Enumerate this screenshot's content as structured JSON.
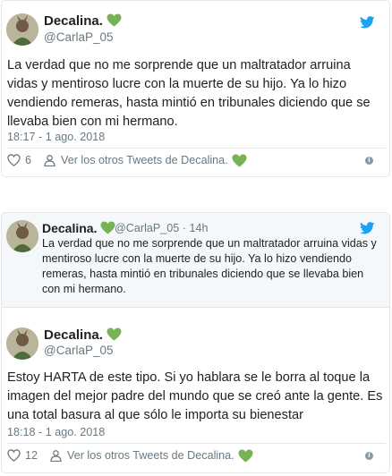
{
  "tweet1": {
    "display_name": "Decalina.",
    "handle": "@CarlaP_05",
    "text": "La verdad que no me sorprende que un maltratador arruina vidas y mentiroso lucre con la muerte de su hijo. Ya lo hizo vendiendo remeras, hasta mintió en tribunales diciendo que se llevaba bien con mi hermano.",
    "timestamp": "18:17 - 1 ago. 2018",
    "likes": "6",
    "more_tweets": "Ver los otros Tweets de Decalina."
  },
  "tweet2": {
    "display_name": "Decalina.",
    "handle": "@CarlaP_05",
    "time_ago": "14h",
    "separator": "·",
    "text": "La verdad que no me sorprende que un maltratador arruina vidas y mentiroso lucre con la muerte de su hijo. Ya lo hizo vendiendo remeras, hasta mintió en tribunales diciendo que se llevaba bien con mi hermano."
  },
  "tweet3": {
    "display_name": "Decalina.",
    "handle": "@CarlaP_05",
    "text": "Estoy HARTA de este tipo. Si yo hablara se le borra al toque la imagen del mejor padre del mundo que se creó ante la gente. Es una total basura al que sólo le importa su bienestar",
    "timestamp": "18:18 - 1 ago. 2018",
    "likes": "12",
    "more_tweets": "Ver los otros Tweets de Decalina."
  },
  "icons": {
    "bird": "twitter-bird-icon",
    "heart_emoji": "green-heart-icon",
    "like": "heart-outline-icon",
    "person": "person-icon",
    "info": "info-icon"
  },
  "colors": {
    "twitter_blue": "#1da1f2",
    "green_heart": "#77b255",
    "muted_text": "#697882",
    "border": "#e1e8ed"
  },
  "info_glyph": "i"
}
